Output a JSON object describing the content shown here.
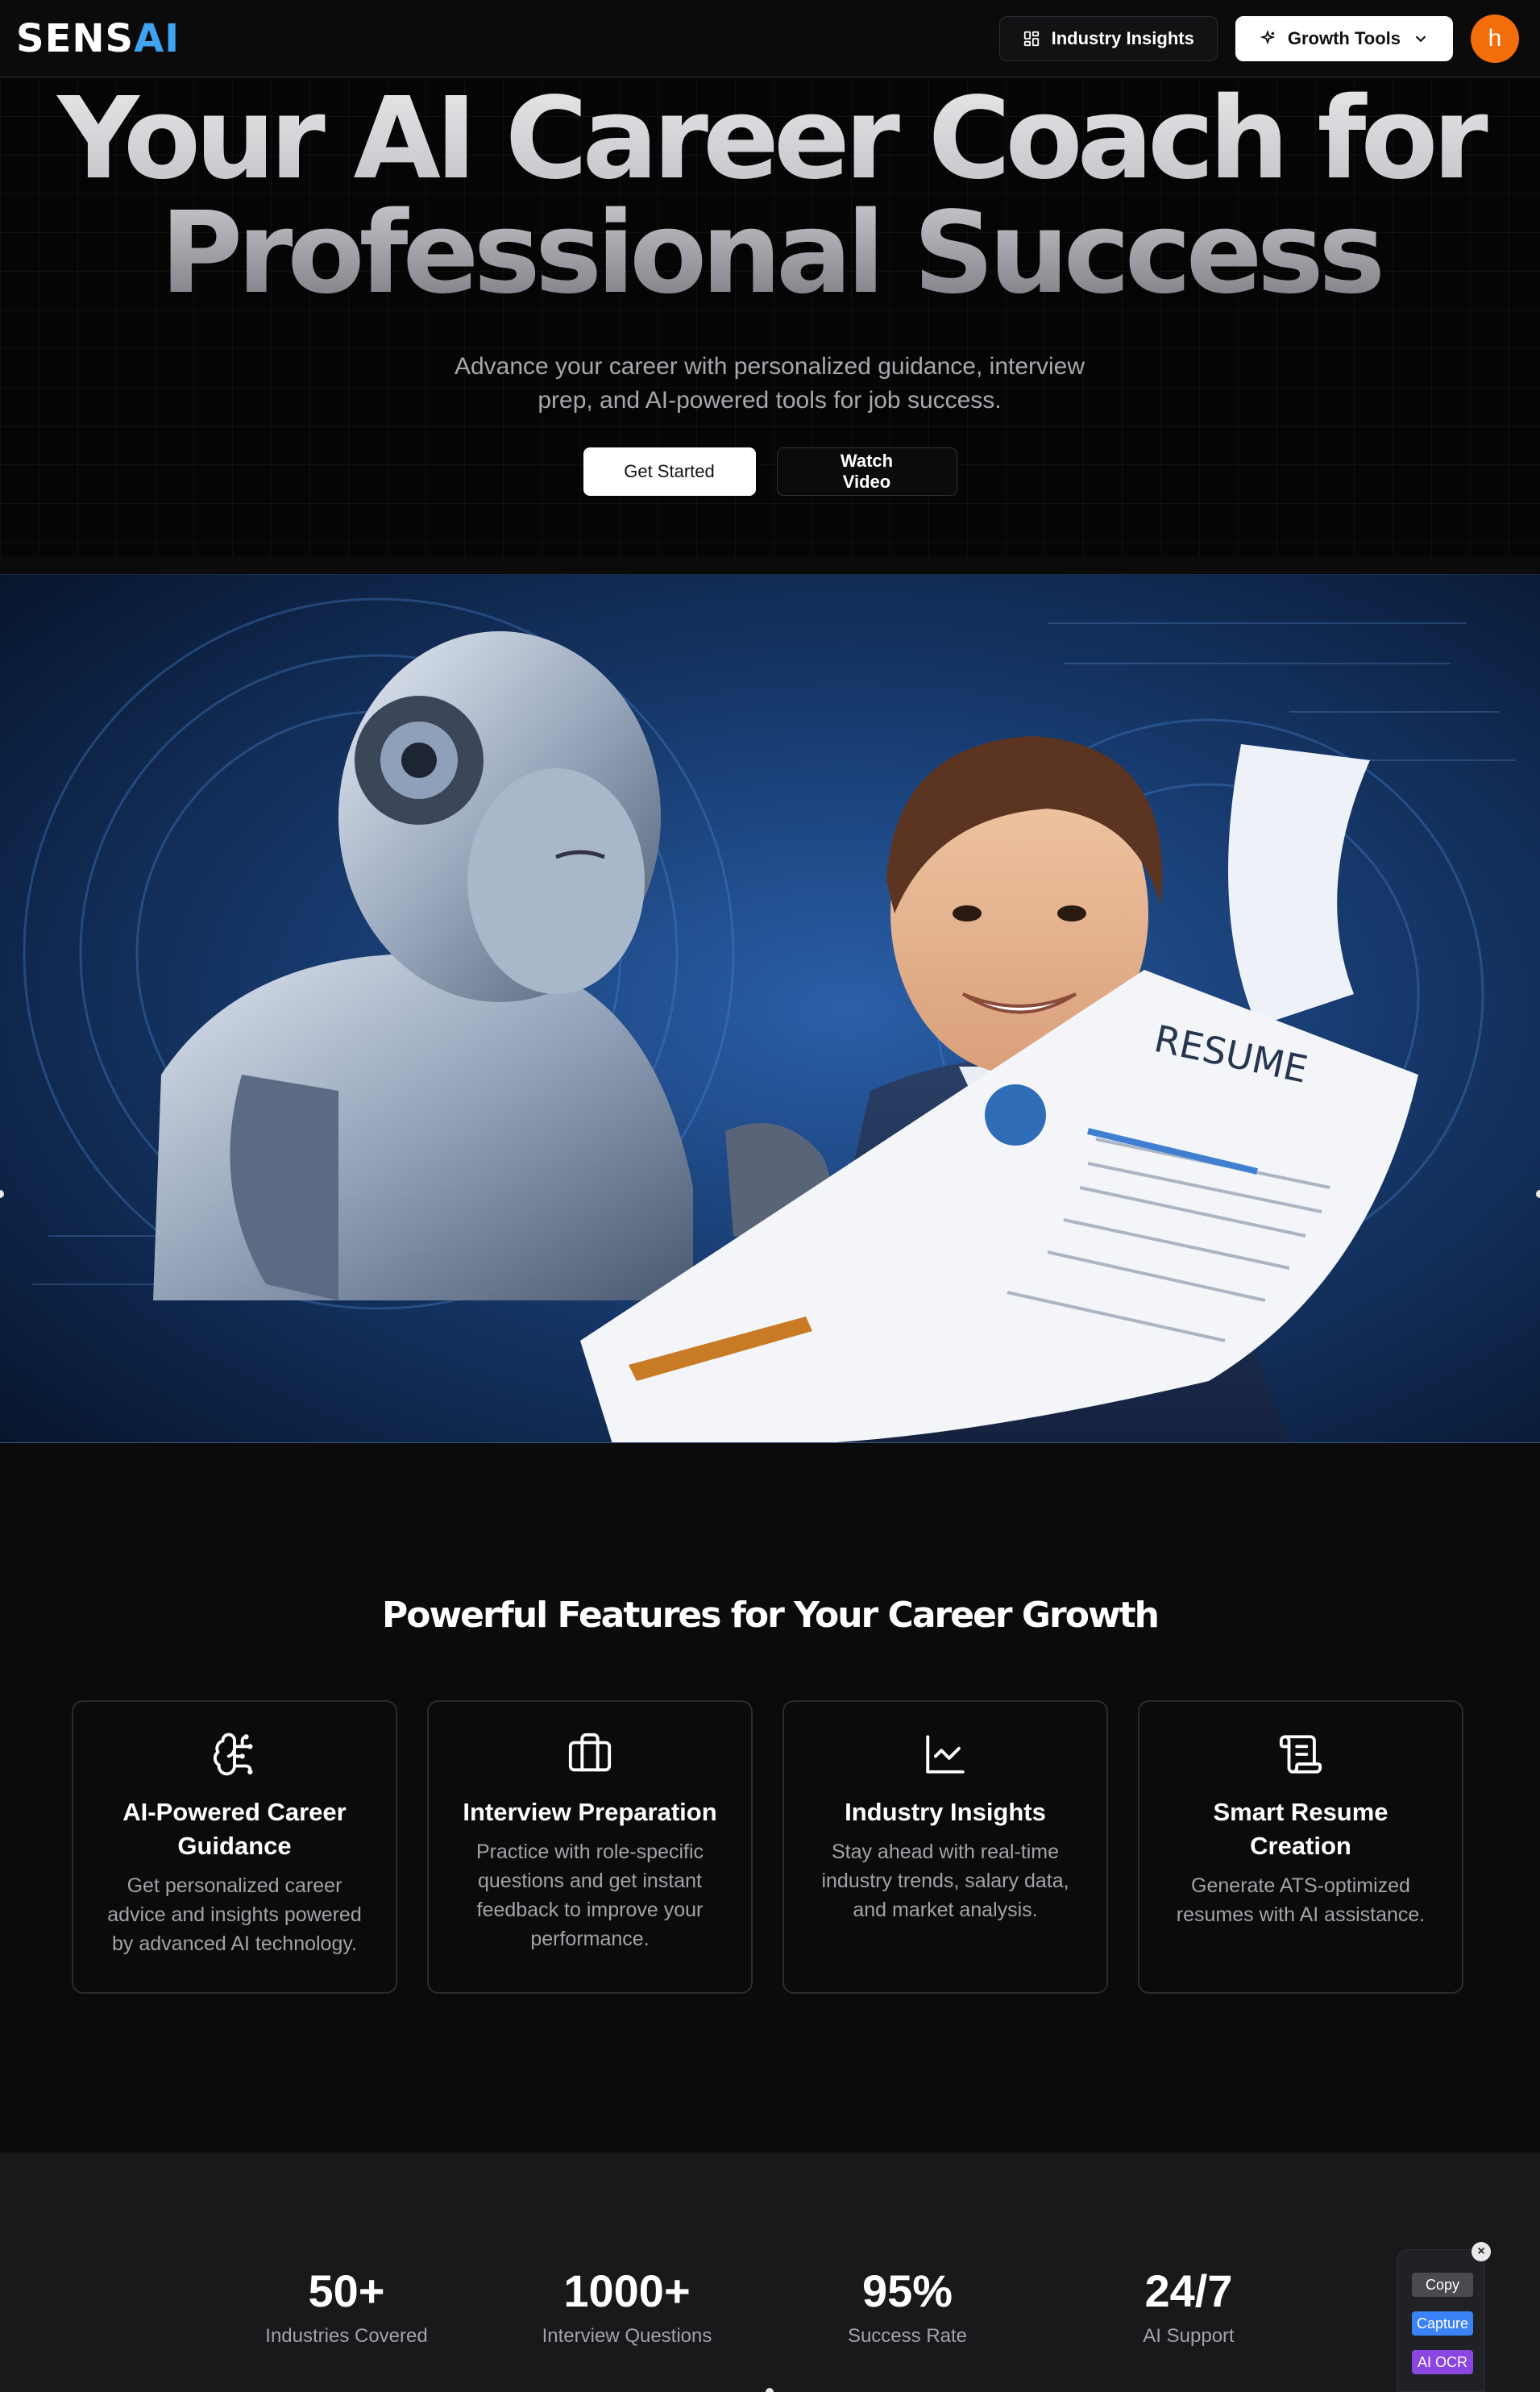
{
  "header": {
    "logo_main": "SENS",
    "logo_accent": "AI",
    "industry_insights_label": "Industry Insights",
    "growth_tools_label": "Growth Tools",
    "avatar_letter": "h"
  },
  "hero": {
    "title_line1": "Your AI Career Coach for",
    "title_line2": "Professional Success",
    "subtitle_line1": "Advance your career with personalized guidance, interview",
    "subtitle_line2": "prep, and AI-powered tools for job success.",
    "get_started_label": "Get Started",
    "watch_video_label": "Watch Video"
  },
  "illustration": {
    "resume_heading": "RESUME"
  },
  "features": {
    "title": "Powerful Features for Your Career Growth",
    "cards": [
      {
        "icon": "brain-circuit-icon",
        "title_line1": "AI-Powered Career",
        "title_line2": "Guidance",
        "desc_lines": [
          "Get personalized career",
          "advice and insights powered",
          "by advanced AI technology."
        ]
      },
      {
        "icon": "briefcase-icon",
        "title_line1": "Interview Preparation",
        "title_line2": "",
        "desc_lines": [
          "Practice with role-specific",
          "questions and get instant",
          "feedback to improve your",
          "performance."
        ]
      },
      {
        "icon": "line-chart-icon",
        "title_line1": "Industry Insights",
        "title_line2": "",
        "desc_lines": [
          "Stay ahead with real-time",
          "industry trends, salary data,",
          "and market analysis."
        ]
      },
      {
        "icon": "scroll-text-icon",
        "title_line1": "Smart Resume",
        "title_line2": "Creation",
        "desc_lines": [
          "Generate ATS-optimized",
          "resumes with AI assistance."
        ]
      }
    ]
  },
  "stats": [
    {
      "value": "50+",
      "label": "Industries Covered"
    },
    {
      "value": "1000+",
      "label": "Interview Questions"
    },
    {
      "value": "95%",
      "label": "Success Rate"
    },
    {
      "value": "24/7",
      "label": "AI Support"
    }
  ],
  "widget": {
    "close_glyph": "×",
    "copy_label": "Copy",
    "capture_label": "Capture",
    "ocr_label": "AI OCR"
  },
  "colors": {
    "background": "#0b0b0c",
    "accent_blue": "#3fa3f0",
    "avatar_orange": "#f46d0b",
    "stats_band": "#19191b"
  }
}
